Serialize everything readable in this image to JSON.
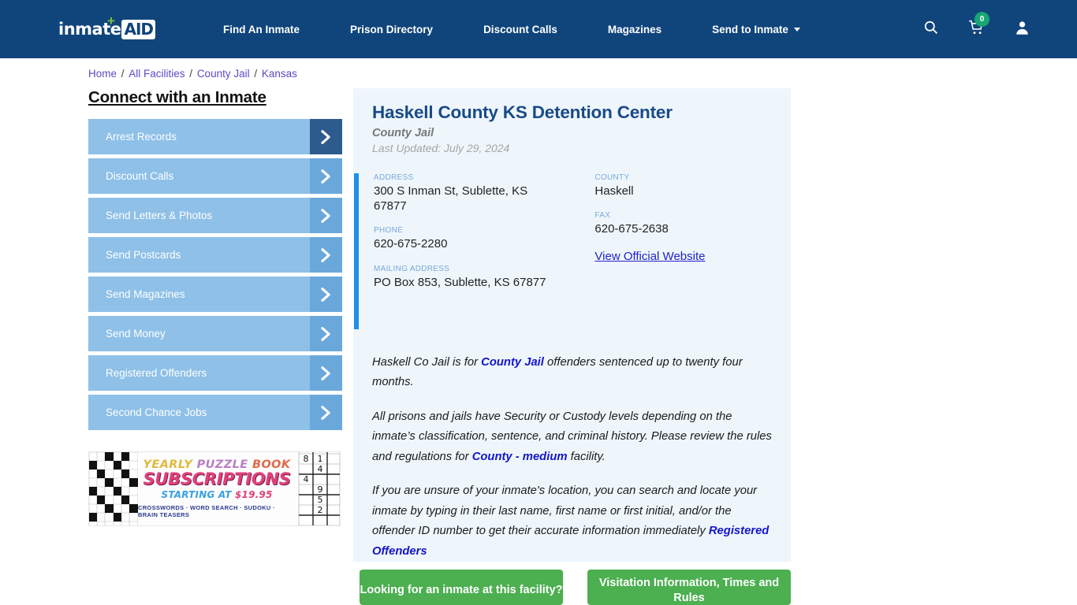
{
  "header": {
    "logo": {
      "word": "inmate",
      "badge": "AID",
      "plus": "+"
    },
    "nav": [
      {
        "label": "Find An Inmate",
        "dropdown": false
      },
      {
        "label": "Prison Directory",
        "dropdown": false
      },
      {
        "label": "Discount Calls",
        "dropdown": false
      },
      {
        "label": "Magazines",
        "dropdown": false
      },
      {
        "label": "Send to Inmate",
        "dropdown": true
      }
    ],
    "icons": {
      "search": "search-icon",
      "cart": "shopping-cart-icon",
      "cart_count": "0",
      "account": "user-account-icon"
    },
    "colors": {
      "bar": "#10457c",
      "badge": "#17a673"
    }
  },
  "breadcrumb": {
    "items": [
      "Home",
      "All Facilities",
      "County Jail",
      "Kansas"
    ],
    "separator": "/"
  },
  "sidebar": {
    "title": "Connect with an Inmate",
    "items": [
      {
        "label": "Arrest Records",
        "active": true
      },
      {
        "label": "Discount Calls",
        "active": false
      },
      {
        "label": "Send Letters & Photos",
        "active": false
      },
      {
        "label": "Send Postcards",
        "active": false
      },
      {
        "label": "Send Magazines",
        "active": false
      },
      {
        "label": "Send Money",
        "active": false
      },
      {
        "label": "Registered Offenders",
        "active": false
      },
      {
        "label": "Second Chance Jobs",
        "active": false
      }
    ]
  },
  "ad": {
    "line1_a": "YEARLY ",
    "line1_b": "PUZZLE ",
    "line1_c": "BOOK",
    "line2": "SUBSCRIPTIONS",
    "line3_pre": "STARTING AT ",
    "line3_amount": "$19.95",
    "line4": "CROSSWORDS · WORD SEARCH · SUDOKU · BRAIN TEASERS",
    "sudoku_digits": [
      "8",
      "1",
      "4",
      "4",
      "9",
      "5",
      "2"
    ]
  },
  "facility": {
    "title": "Haskell County KS Detention Center",
    "type": "County Jail",
    "last_updated": "Last Updated: July 29, 2024",
    "fields": {
      "address_label": "ADDRESS",
      "address_value": "300 S Inman St, Sublette, KS 67877",
      "county_label": "COUNTY",
      "county_value": "Haskell",
      "phone_label": "PHONE",
      "phone_value": "620-675-2280",
      "fax_label": "FAX",
      "fax_value": "620-675-2638",
      "mailing_label": "MAILING ADDRESS",
      "mailing_value": "PO Box 853, Sublette, KS 67877",
      "website_link": "View Official Website"
    },
    "paragraphs": {
      "p1_pre": "Haskell Co Jail is for ",
      "p1_link": "County Jail",
      "p1_post": " offenders sentenced up to twenty four months.",
      "p2_pre": "All prisons and jails have Security or Custody levels depending on the inmate’s classification, sentence, and criminal history. Please review the rules and regulations for ",
      "p2_link": "County - medium",
      "p2_post": " facility.",
      "p3_pre": "If you are unsure of your inmate's location, you can search and locate your inmate by typing in their last name, first name or first initial, and/or the offender ID number to get their accurate information immediately ",
      "p3_link": "Registered Offenders"
    }
  },
  "buttons": {
    "inmate_search": "Looking for an inmate at this facility?",
    "visitation": "Visitation Information, Times and Rules",
    "color": "#4caf50"
  }
}
